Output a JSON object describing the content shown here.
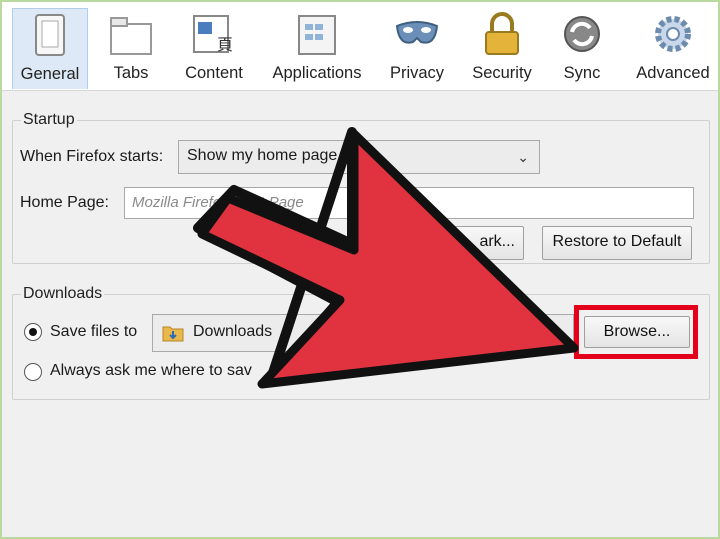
{
  "toolbar": {
    "tabs": [
      {
        "label": "General",
        "icon": "general-switch-icon",
        "active": true
      },
      {
        "label": "Tabs",
        "icon": "tabs-window-icon"
      },
      {
        "label": "Content",
        "icon": "content-page-icon"
      },
      {
        "label": "Applications",
        "icon": "applications-grid-icon"
      },
      {
        "label": "Privacy",
        "icon": "privacy-mask-icon"
      },
      {
        "label": "Security",
        "icon": "security-lock-icon"
      },
      {
        "label": "Sync",
        "icon": "sync-arrows-icon"
      },
      {
        "label": "Advanced",
        "icon": "advanced-gear-icon"
      }
    ]
  },
  "startup": {
    "legend": "Startup",
    "when_label": "When Firefox starts:",
    "when_value": "Show my home page",
    "home_label": "Home Page:",
    "home_placeholder": "Mozilla Firefox Start Page",
    "bookmark_button_partial": "ark...",
    "restore_button": "Restore to Default"
  },
  "downloads": {
    "legend": "Downloads",
    "save_label": "Save files to",
    "folder": "Downloads",
    "browse_button": "Browse...",
    "ask_label": "Always ask me where to sav"
  },
  "overlay": {
    "arrow_color": "#e0333f",
    "highlight_color": "#e4001b"
  }
}
